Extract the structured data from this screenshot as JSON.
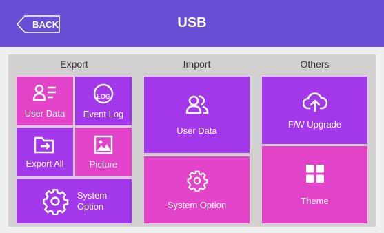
{
  "header": {
    "title": "USB",
    "back_label": "BACK"
  },
  "sections": {
    "export": "Export",
    "import": "Import",
    "others": "Others"
  },
  "export_tiles": {
    "user_data": "User Data",
    "event_log": "Event Log",
    "event_log_badge": "LOG",
    "export_all": "Export All",
    "picture": "Picture",
    "system_option_line1": "System",
    "system_option_line2": "Option"
  },
  "import_tiles": {
    "user_data": "User Data",
    "system_option": "System Option"
  },
  "others_tiles": {
    "fw_upgrade": "F/W Upgrade",
    "theme": "Theme"
  },
  "colors": {
    "header": "#6a4fd6",
    "pink": "#e243c8",
    "purple": "#a238ea",
    "panel": "#d2d0d0"
  }
}
